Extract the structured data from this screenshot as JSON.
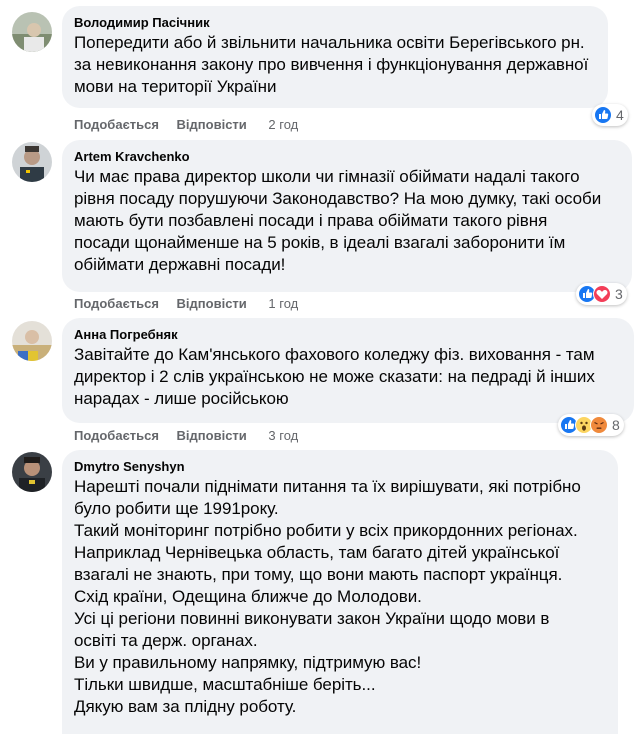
{
  "comments": [
    {
      "author": "Володимир Пасічник",
      "lines": [
        "Попередити або й звільнити начальника освіти Берегівського рн.",
        "за невиконання закону про вивчення і функціонування державної",
        "мови на території України"
      ],
      "like_label": "Подобається",
      "reply_label": "Відповісти",
      "time": "2 год",
      "reaction_count": "4",
      "reactions": [
        "like-icon"
      ]
    },
    {
      "author": "Artem Kravchenko",
      "lines": [
        "Чи має права директор школи чи гімназії обіймати надалі такого",
        "рівня посаду порушуючи Законодавство? На мою думку, такі особи",
        "мають бути позбавлені посади і права обіймати такого рівня",
        "посади щонайменше на 5 років, в ідеалі взагалі заборонити їм",
        "обіймати державні посади!"
      ],
      "like_label": "Подобається",
      "reply_label": "Відповісти",
      "time": "1 год",
      "reaction_count": "3",
      "reactions": [
        "like-icon",
        "love-icon"
      ]
    },
    {
      "author": "Анна Погребняк",
      "lines": [
        "Завітайте до Кам'янського фахового коледжу фіз. виховання - там",
        "директор і 2 слів українською не може сказати: на педраді й інших",
        "нарадах - лише російською"
      ],
      "like_label": "Подобається",
      "reply_label": "Відповісти",
      "time": "3 год",
      "reaction_count": "8",
      "reactions": [
        "like-icon",
        "wow-icon",
        "angry-icon"
      ]
    },
    {
      "author": "Dmytro Senyshyn",
      "lines": [
        "Нарешті почали піднімати питання та їх вирішувати, які потрібно",
        "було робити ще 1991року.",
        "Такий моніторинг потрібно робити у всіх прикордонних регіонах.",
        "Наприклад Чернівецька область, там багато дітей української",
        "взагалі не знають, при тому, що вони мають паспорт українця.",
        "Схід країни, Одещина ближче до Молодови.",
        "Усі ці регіони повинні виконувати закон України щодо мови в",
        "освіті та держ. органах.",
        "Ви у правильному напрямку, підтримую вас!",
        "Тільки швидше, масштабніше беріть...",
        "Дякую вам за плідну роботу."
      ]
    }
  ],
  "colors": {
    "bubble": "#f0f2f5",
    "meta_text": "#65676b",
    "like_blue": "#1877f2",
    "love_red": "#f33e58",
    "wow_yellow": "#fcd561"
  }
}
